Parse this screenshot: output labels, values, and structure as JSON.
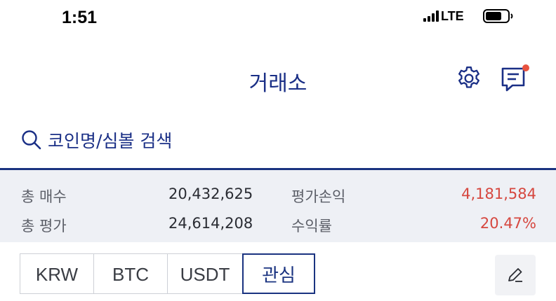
{
  "status_bar": {
    "time": "1:51",
    "network": "LTE"
  },
  "header": {
    "title": "거래소"
  },
  "search": {
    "placeholder": "코인명/심볼 검색"
  },
  "summary": {
    "total_buy_label": "총 매수",
    "total_buy_value": "20,432,625",
    "total_eval_label": "총 평가",
    "total_eval_value": "24,614,208",
    "pnl_label": "평가손익",
    "pnl_value": "4,181,584",
    "return_label": "수익률",
    "return_value": "20.47%"
  },
  "tabs": [
    {
      "label": "KRW",
      "active": false
    },
    {
      "label": "BTC",
      "active": false
    },
    {
      "label": "USDT",
      "active": false
    },
    {
      "label": "관심",
      "active": true
    }
  ],
  "colors": {
    "brand": "#1a3380",
    "positive": "#d6473f",
    "notification_dot": "#e8523f"
  },
  "icons": {
    "search": "search-icon",
    "settings": "gear-icon",
    "chat": "chat-icon",
    "edit": "pencil-icon"
  }
}
